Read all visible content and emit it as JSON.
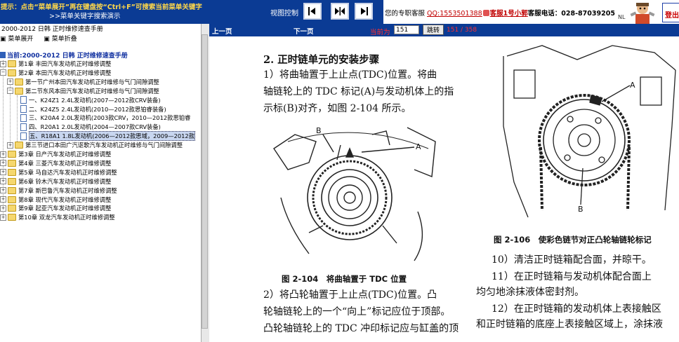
{
  "top": {
    "hint_line1": "提示：点击“菜单展开”再在键盘按“Ctrl+F”可搜索当前菜单关键字",
    "hint_line2": ">>菜单关键字搜索演示",
    "view_control_label": "视图控制",
    "contact_prefix": "您的专职客服",
    "contact_qq": "QQ:1553501388",
    "contact_service": "客服1号小郭",
    "contact_phone": "客服电话：028-87039205",
    "nl_label": "NL",
    "logout_label": "登出"
  },
  "left": {
    "title": "2000-2012 日韩 正时维修速查手册",
    "tool_expand": "菜单展开",
    "tool_collapse": "菜单折叠",
    "root": "当前:2000-2012 日韩 正时维修速查手册",
    "tree": [
      "第1章 丰田汽车发动机正时维修调整",
      "第2章 本田汽车发动机正时维修调整",
      "第一节广州本田汽车发动机正时维修与气门间隙调整",
      "第二节东风本田汽车发动机正时维修与气门间隙调整",
      "一、K24Z1 2.4L发动机(2007—2012款CRV装备)",
      "二、K24Z5 2.4L发动机(2010—2012款思铂睿装备)",
      "三、K20A4 2.0L发动机(2003款CRV，2010—2012款思铂睿",
      "四、R20A1 2.0L发动机(2004—2007款CRV装备)",
      "五、R18A1 1.8L发动机(2006—2012款思域，2009—2012款",
      "第三节进口本田广汽讴歌汽车发动机正时维修与气门间隙调整",
      "第3章 日产汽车发动机正时维修调整",
      "第4章 三菱汽车发动机正时维修调整",
      "第5章 马自达汽车发动机正时维修调整",
      "第6章 铃木汽车发动机正时维修调整",
      "第7章 斯巴鲁汽车发动机正时维修调整",
      "第8章 现代汽车发动机正时维修调整",
      "第9章 起亚汽车发动机正时维修调整",
      "第10章 双龙汽车发动机正时维修调整"
    ]
  },
  "nav": {
    "prev": "上一页",
    "next": "下一页",
    "current_label": "当前为",
    "current_page": "151",
    "go": "跳转",
    "count": "151 / 358"
  },
  "doc": {
    "heading": "2. 正时链单元的安装步骤",
    "p1_l1": "1）将曲轴置于上止点(TDC)位置。将曲",
    "p1_l2": "轴链轮上的 TDC 标记(A)与发动机体上的指",
    "p1_l3": "示标(B)对齐，如图 2-104 所示。",
    "fig104_caption": "图 2-104　将曲轴置于 TDC 位置",
    "p2_l1": "2）将凸轮轴置于上止点(TDC)位置。凸",
    "p2_l2": "轮轴链轮上的一个“向上”标记应位于顶部。",
    "p2_l3": "凸轮轴链轮上的 TDC 冲印标记应与缸盖的顶",
    "fig106_caption": "图 2-106　使彩色链节对正凸轮轴链轮标记",
    "p10": "10）清洁正时链箱配合面，并晾干。",
    "p11_l1": "11）在正时链箱与发动机体配合面上",
    "p11_l2": "均匀地涂抹液体密封剂。",
    "p12_l1": "12）在正时链箱的发动机体上表接触区",
    "p12_l2": "和正时链箱的底座上表接触区域上，涂抹液",
    "label_a": "A",
    "label_b": "B"
  }
}
